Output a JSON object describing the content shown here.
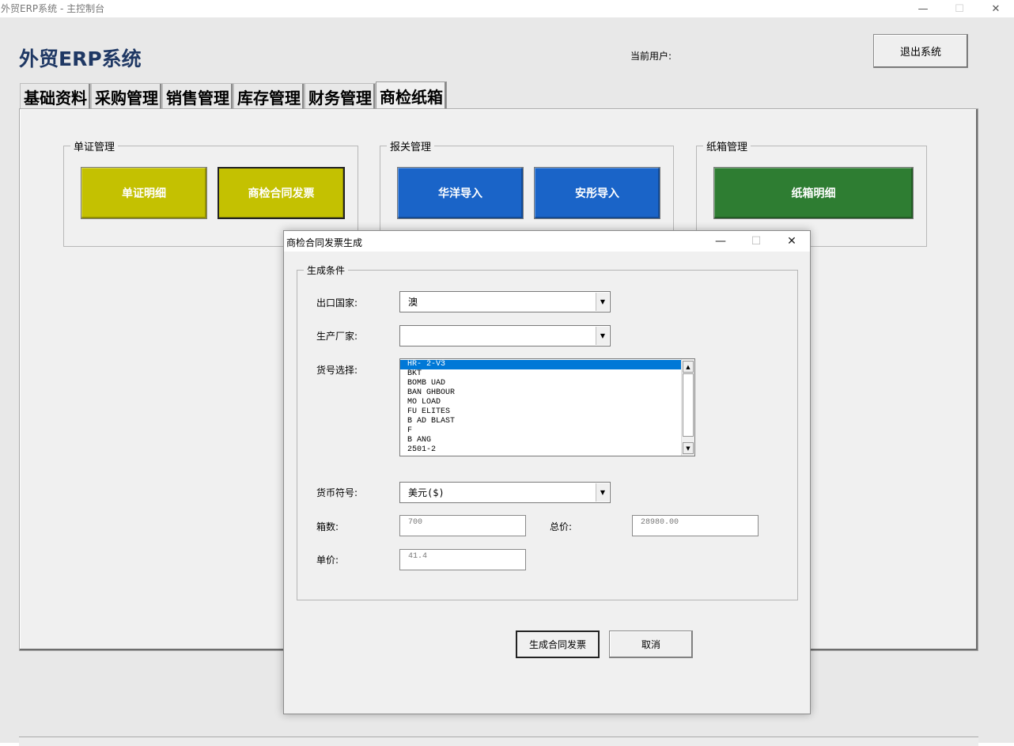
{
  "window": {
    "title": "外贸ERP系统 - 主控制台",
    "minimize": "—",
    "maximize": "☐",
    "close": "✕"
  },
  "header": {
    "app_title": "外贸ERP系统",
    "current_user_label": "当前用户:",
    "exit_button": "退出系统"
  },
  "tabs": [
    {
      "label": "基础资料"
    },
    {
      "label": "采购管理"
    },
    {
      "label": "销售管理"
    },
    {
      "label": "库存管理"
    },
    {
      "label": "财务管理"
    },
    {
      "label": "商检纸箱",
      "active": true
    }
  ],
  "groups": {
    "docs": {
      "title": "单证管理",
      "buttons": [
        "单证明细",
        "商检合同发票"
      ]
    },
    "customs": {
      "title": "报关管理",
      "buttons": [
        "华洋导入",
        "安彤导入"
      ]
    },
    "carton": {
      "title": "纸箱管理",
      "buttons": [
        "纸箱明细"
      ]
    }
  },
  "colors": {
    "olive": "#c4c101",
    "blue": "#1a64c8",
    "green": "#2e7d32",
    "title_blue": "#1f3864",
    "selection": "#0078d7"
  },
  "dialog": {
    "title": "商检合同发票生成",
    "group_title": "生成条件",
    "fields": {
      "export_country_label": "出口国家:",
      "export_country_value": "澳",
      "manufacturer_label": "生产厂家:",
      "manufacturer_value": "",
      "item_no_label": "货号选择:",
      "currency_label": "货币符号:",
      "currency_value": "美元($)",
      "boxes_label": "箱数:",
      "boxes_value": "700",
      "total_label": "总价:",
      "total_value": "28980.00",
      "unit_price_label": "单价:",
      "unit_price_value": "41.4"
    },
    "item_list": [
      {
        "text": "HR-    2-V3",
        "selected": true
      },
      {
        "text": "BKT"
      },
      {
        "text": "BOMB   UAD"
      },
      {
        "text": "BAN   GHBOUR"
      },
      {
        "text": "MO    LOAD"
      },
      {
        "text": "FU    ELITES"
      },
      {
        "text": "B     AD BLAST"
      },
      {
        "text": "F"
      },
      {
        "text": "B   ANG"
      },
      {
        "text": "2501-2"
      }
    ],
    "buttons": {
      "generate": "生成合同发票",
      "cancel": "取消"
    }
  }
}
